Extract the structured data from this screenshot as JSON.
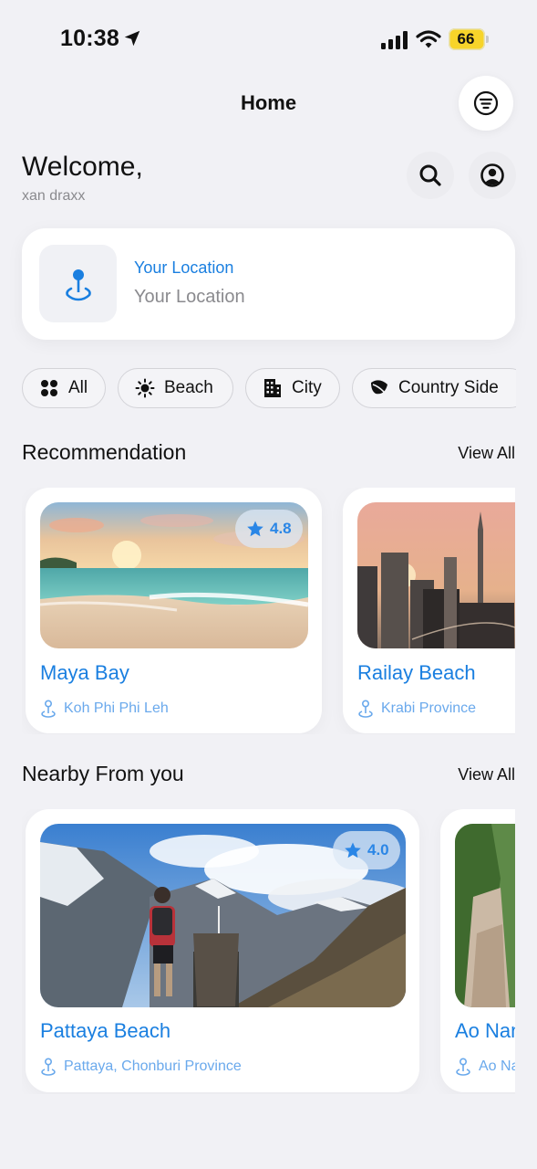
{
  "status_bar": {
    "time": "10:38",
    "battery": "66"
  },
  "header": {
    "title": "Home"
  },
  "greeting": {
    "welcome": "Welcome,",
    "username": "xan draxx"
  },
  "location": {
    "label": "Your Location",
    "value": "Your Location"
  },
  "categories": [
    {
      "label": "All",
      "icon": "grid-icon"
    },
    {
      "label": "Beach",
      "icon": "sun-icon"
    },
    {
      "label": "City",
      "icon": "building-icon"
    },
    {
      "label": "Country Side",
      "icon": "leaf-icon"
    }
  ],
  "recommendation": {
    "title": "Recommendation",
    "view_all": "View All",
    "items": [
      {
        "name": "Maya Bay",
        "location": "Koh Phi Phi Leh",
        "rating": "4.8"
      },
      {
        "name": "Railay Beach",
        "location": "Krabi Province"
      }
    ]
  },
  "nearby": {
    "title": "Nearby From you",
    "view_all": "View All",
    "items": [
      {
        "name": "Pattaya Beach",
        "location": "Pattaya, Chonburi Province",
        "rating": "4.0"
      },
      {
        "name": "Ao Nang",
        "location": "Ao Nang"
      }
    ]
  },
  "colors": {
    "accent": "#1a7fe0",
    "background": "#f1f1f5",
    "card": "#ffffff"
  }
}
